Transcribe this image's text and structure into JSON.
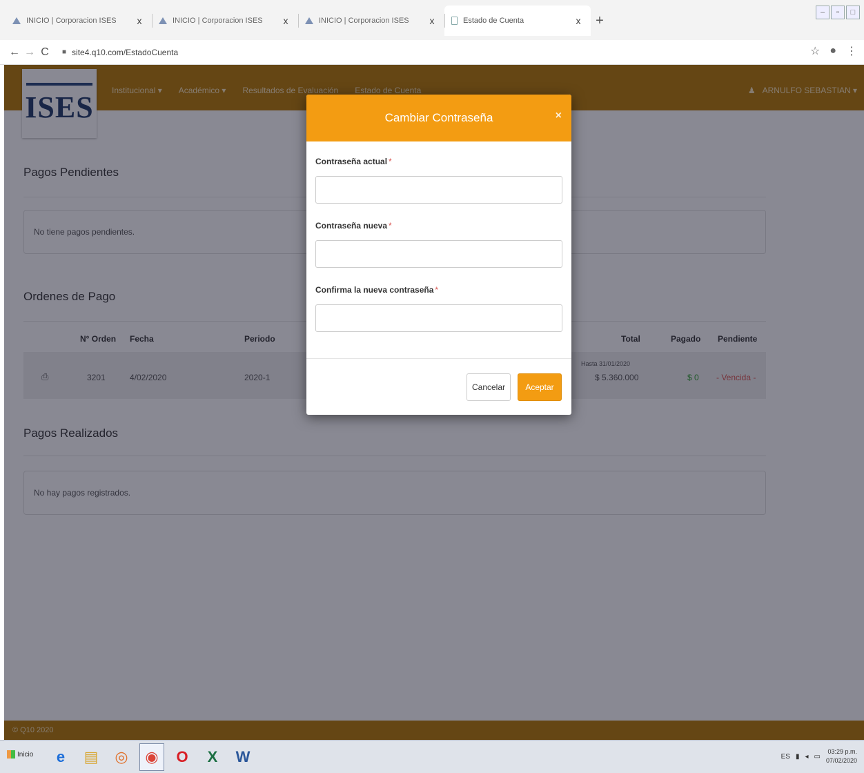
{
  "browser": {
    "tabs": [
      {
        "title": "INICIO | Corporacion ISES",
        "icon": "ises-favicon-icon",
        "active": false
      },
      {
        "title": "INICIO | Corporacion ISES",
        "icon": "ises-favicon-icon",
        "active": false
      },
      {
        "title": "INICIO | Corporacion ISES",
        "icon": "ises-favicon-icon",
        "active": false
      },
      {
        "title": "Estado de Cuenta",
        "icon": "page-favicon-icon",
        "active": true
      }
    ],
    "close_glyph": "x",
    "new_tab_glyph": "+",
    "url": "site4.q10.com/EstadoCuenta"
  },
  "header": {
    "logo_text": "ISES",
    "menu": [
      "Institucional ▾",
      "Académico ▾",
      "Resultados de Evaluación",
      "Estado de Cuenta"
    ],
    "user": "ARNULFO SEBASTIAN ▾"
  },
  "pending": {
    "title": "Pagos Pendientes",
    "message": "No tiene pagos pendientes."
  },
  "orders": {
    "title": "Ordenes de Pago",
    "columns": {
      "order": "N° Orden",
      "date": "Fecha",
      "period": "Periodo",
      "total": "Total",
      "paid": "Pagado",
      "pending": "Pendiente"
    },
    "rows": [
      {
        "order": "3201",
        "date": "4/02/2020",
        "period": "2020-1",
        "due": "Hasta 31/01/2020",
        "total": "$ 5.360.000",
        "paid": "$ 0",
        "pending": "- Vencida -"
      }
    ]
  },
  "done": {
    "title": "Pagos Realizados",
    "message": "No hay pagos registrados."
  },
  "footer": {
    "text": "© Q10 2020"
  },
  "modal": {
    "title": "Cambiar Contraseña",
    "close_glyph": "×",
    "fields": [
      {
        "label": "Contraseña actual",
        "value": ""
      },
      {
        "label": "Contraseña nueva",
        "value": ""
      },
      {
        "label": "Confirma la nueva contraseña",
        "value": ""
      }
    ],
    "required_mark": "*",
    "cancel": "Cancelar",
    "accept": "Aceptar"
  },
  "taskbar": {
    "start": "Inicio",
    "lang": "ES",
    "time": "03:29 p.m.",
    "date": "07/02/2020"
  },
  "colors": {
    "header": "#b77900",
    "modal_accent": "#f39c12",
    "paid_green": "#2e9e2e",
    "overdue_red": "#d9534f"
  }
}
